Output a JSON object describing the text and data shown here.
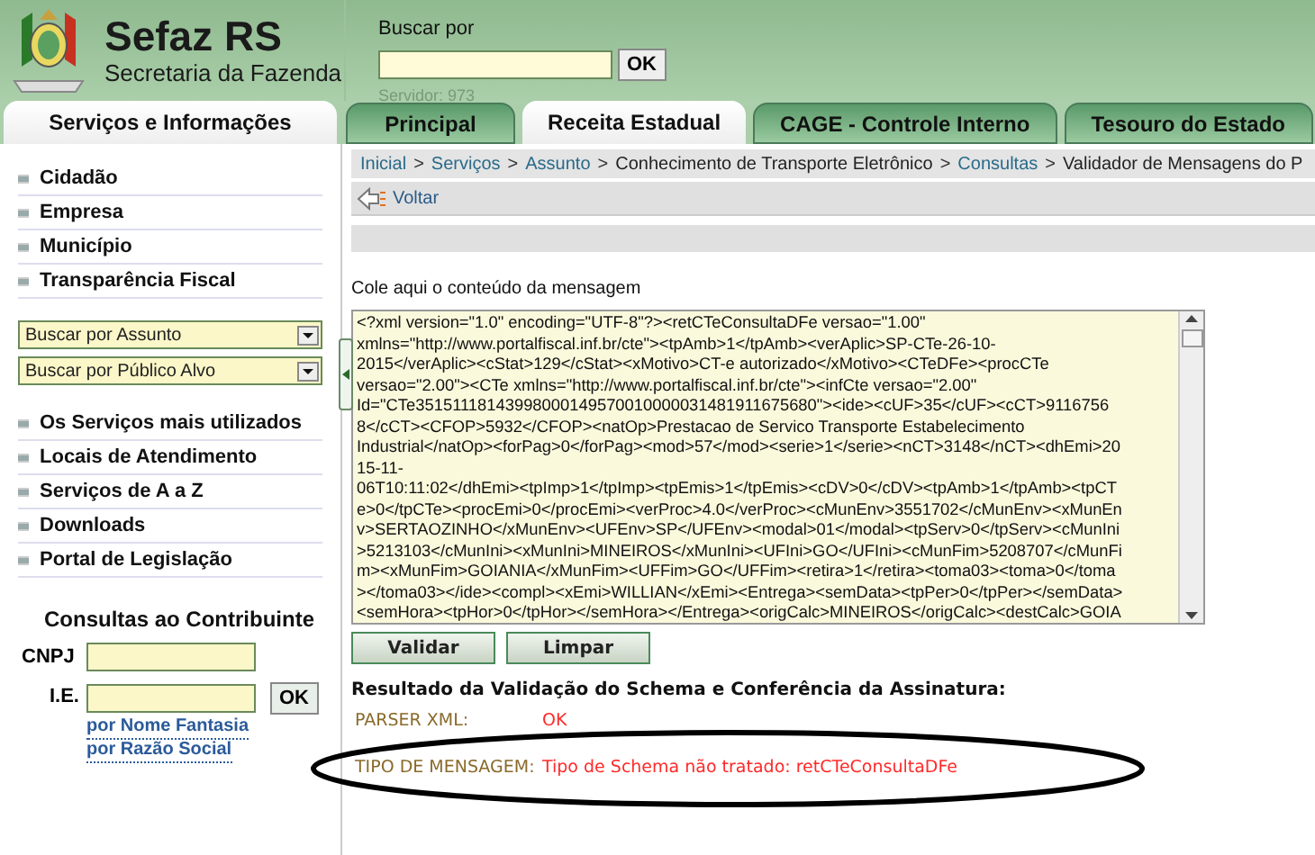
{
  "header": {
    "title": "Sefaz RS",
    "subtitle": "Secretaria da Fazenda",
    "search": {
      "label": "Buscar por",
      "button": "OK",
      "server": "Servidor: 973"
    }
  },
  "sidebar": {
    "tab": "Serviços e Informações",
    "top_items": [
      "Cidadão",
      "Empresa",
      "Município",
      "Transparência Fiscal"
    ],
    "selects": [
      "Buscar por Assunto",
      "Buscar por Público Alvo"
    ],
    "bottom_items": [
      "Os Serviços mais utilizados",
      "Locais de Atendimento",
      "Serviços de A a Z",
      "Downloads",
      "Portal de Legislação"
    ],
    "consultas": {
      "title": "Consultas ao Contribuinte",
      "cnpj_label": "CNPJ",
      "ie_label": "I.E.",
      "button": "OK",
      "links": [
        "por Nome Fantasia",
        "por Razão Social"
      ]
    }
  },
  "tabs": [
    {
      "label": "Principal",
      "selected": false
    },
    {
      "label": "Receita Estadual",
      "selected": true
    },
    {
      "label": "CAGE - Controle Interno",
      "selected": false
    },
    {
      "label": "Tesouro do Estado",
      "selected": false
    }
  ],
  "breadcrumb": [
    {
      "label": "Inicial",
      "kind": "link"
    },
    {
      "separator": ">",
      "label": "Serviços",
      "kind": "link"
    },
    {
      "separator": ">",
      "label": "Assunto",
      "kind": "link"
    },
    {
      "separator": ">",
      "label": "Conhecimento de Transporte Eletrônico",
      "kind": "text"
    },
    {
      "separator": ">",
      "label": "Consultas",
      "kind": "link"
    },
    {
      "separator": ">",
      "label": "Validador de Mensagens do P",
      "kind": "text"
    }
  ],
  "back": "Voltar",
  "message_label": "Cole aqui o conteúdo da mensagem",
  "message_lines": [
    "<?xml version=\"1.0\" encoding=\"UTF-8\"?><retCTeConsultaDFe versao=\"1.00\"",
    "xmlns=\"http://www.portalfiscal.inf.br/cte\"><tpAmb>1</tpAmb><verAplic>SP-CTe-26-10-",
    "2015</verAplic><cStat>129</cStat><xMotivo>CT-e autorizado</xMotivo><CTeDFe><procCTe",
    "versao=\"2.00\"><CTe xmlns=\"http://www.portalfiscal.inf.br/cte\"><infCte versao=\"2.00\"",
    "Id=\"CTe35151118143998000149570010000031481911675680\"><ide><cUF>35</cUF><cCT>9116756",
    "8</cCT><CFOP>5932</CFOP><natOp>Prestacao de Servico Transporte Estabelecimento",
    "Industrial</natOp><forPag>0</forPag><mod>57</mod><serie>1</serie><nCT>3148</nCT><dhEmi>20",
    "15-11-",
    "06T10:11:02</dhEmi><tpImp>1</tpImp><tpEmis>1</tpEmis><cDV>0</cDV><tpAmb>1</tpAmb><tpCT",
    "e>0</tpCTe><procEmi>0</procEmi><verProc>4.0</verProc><cMunEnv>3551702</cMunEnv><xMunEn",
    "v>SERTAOZINHO</xMunEnv><UFEnv>SP</UFEnv><modal>01</modal><tpServ>0</tpServ><cMunIni",
    ">5213103</cMunIni><xMunIni>MINEIROS</xMunIni><UFIni>GO</UFIni><cMunFim>5208707</cMunFi",
    "m><xMunFim>GOIANIA</xMunFim><UFFim>GO</UFFim><retira>1</retira><toma03><toma>0</toma",
    "></toma03></ide><compl><xEmi>WILLIAN</xEmi><Entrega><semData><tpPer>0</tpPer></semData>",
    "<semHora><tpHor>0</tpHor></semHora></Entrega><origCalc>MINEIROS</origCalc><destCalc>GOIA"
  ],
  "buttons": [
    "Validar",
    "Limpar"
  ],
  "result": {
    "title": "Resultado da Validação do Schema e Conferência da Assinatura:",
    "rows": [
      {
        "label": "PARSER XML:",
        "value": "OK"
      },
      {
        "label": "TIPO DE MENSAGEM:",
        "value": "Tipo de Schema não tratado: retCTeConsultaDFe"
      }
    ]
  }
}
